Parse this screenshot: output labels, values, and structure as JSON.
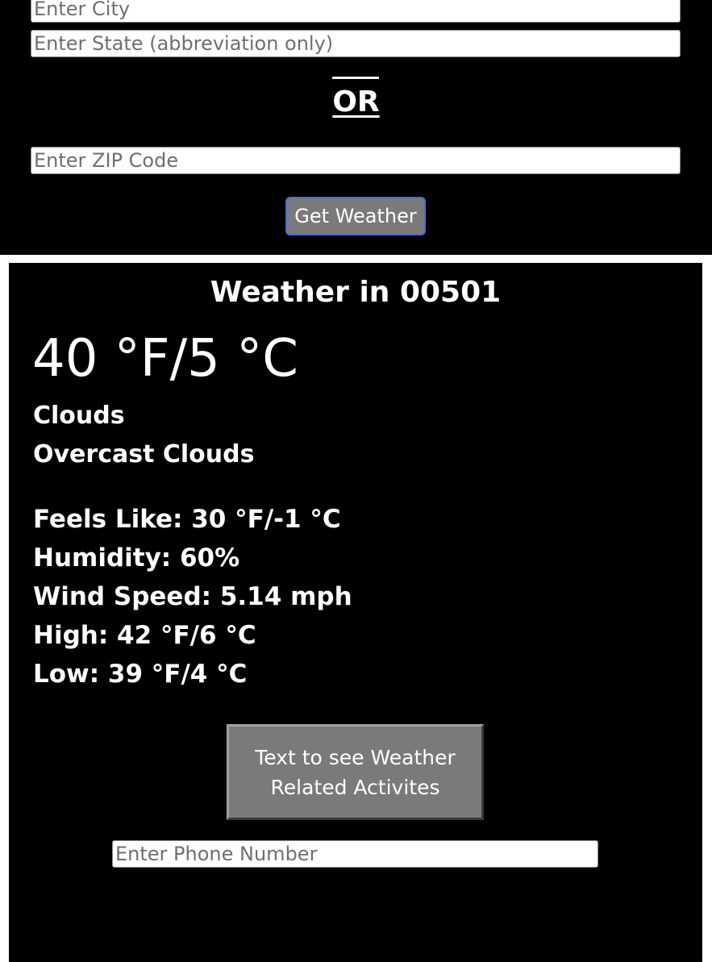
{
  "form": {
    "city_placeholder": "Enter City",
    "state_placeholder": "Enter State (abbreviation only)",
    "or_label": "OR",
    "zip_placeholder": "Enter ZIP Code",
    "get_weather_label": "Get Weather"
  },
  "weather": {
    "title": "Weather in 00501",
    "temperature": "40 °F/5 °C",
    "condition": "Clouds",
    "description": "Overcast Clouds",
    "feels_like": "Feels Like: 30 °F/-1 °C",
    "humidity": "Humidity: 60%",
    "wind_speed": "Wind Speed: 5.14 mph",
    "high": "High: 42 °F/6 °C",
    "low": "Low: 39 °F/4 °C"
  },
  "sms": {
    "button_label": "Text to see Weather Related Activites",
    "phone_placeholder": "Enter Phone Number"
  },
  "colors": {
    "background": "#000000",
    "panel_border": "#ffffff",
    "button_gray": "#7a7a7a",
    "focus_blue": "#4a6fd0"
  }
}
